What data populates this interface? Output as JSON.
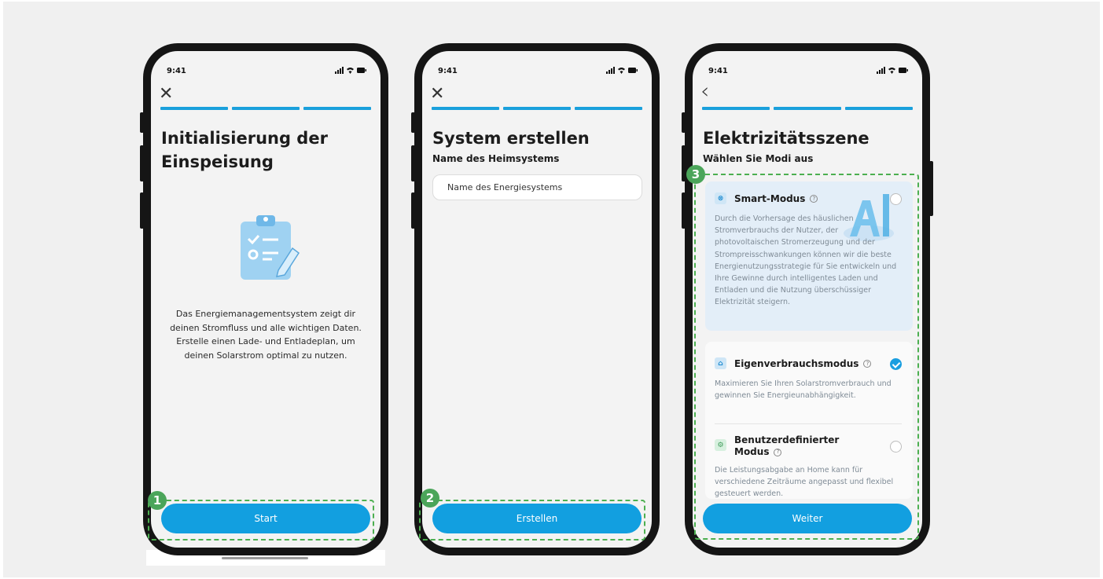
{
  "colors": {
    "accent": "#129fe0",
    "progress": "#1aa0dc",
    "highlight": "#4caf50",
    "badge": "#4ba55a"
  },
  "status": {
    "time": "9:41",
    "icons": "signal wifi battery"
  },
  "screens": [
    {
      "nav_icon": "close-icon",
      "nav_glyph": "✕",
      "title": "Initialisierung der Einspeisung",
      "illustration": "clipboard-icon",
      "description": "Das Energiemanagementsystem zeigt dir deinen Stromfluss und alle wichtigen Daten. Erstelle einen Lade- und Entladeplan, um deinen Solarstrom optimal zu nutzen.",
      "button": "Start",
      "badge": "1"
    },
    {
      "nav_icon": "close-icon",
      "nav_glyph": "✕",
      "title": "System erstellen",
      "subtitle": "Name des Heimsystems",
      "input_placeholder": "Name des Energiesystems",
      "button": "Erstellen",
      "badge": "2"
    },
    {
      "nav_icon": "back-icon",
      "nav_glyph": "‹",
      "title": "Elektrizitätsszene",
      "subtitle": "Wählen Sie Modi aus",
      "badge": "3",
      "modes": [
        {
          "icon": "smart-mode-icon",
          "name": "Smart-Modus",
          "selected": false,
          "description": "Durch die Vorhersage des häuslichen Stromverbrauchs der Nutzer, der photovoltaischen Stromerzeugung und der Strompreisschwankungen können wir die beste Energienutzungsstrategie für Sie entwickeln und Ihre Gewinne durch intelligentes Laden und Entladen und die Nutzung überschüssiger Elektrizität steigern."
        },
        {
          "icon": "home-mode-icon",
          "name": "Eigenverbrauchsmodus",
          "selected": true,
          "description": "Maximieren Sie Ihren Solarstromverbrauch und gewinnen Sie Energieunabhängigkeit."
        },
        {
          "icon": "custom-mode-icon",
          "name_line1": "Benutzerdefinierter",
          "name_line2": "Modus",
          "selected": false,
          "description": "Die Leistungsabgabe an Home kann für verschiedene Zeiträume angepasst und flexibel gesteuert werden."
        }
      ],
      "button": "Weiter"
    }
  ]
}
